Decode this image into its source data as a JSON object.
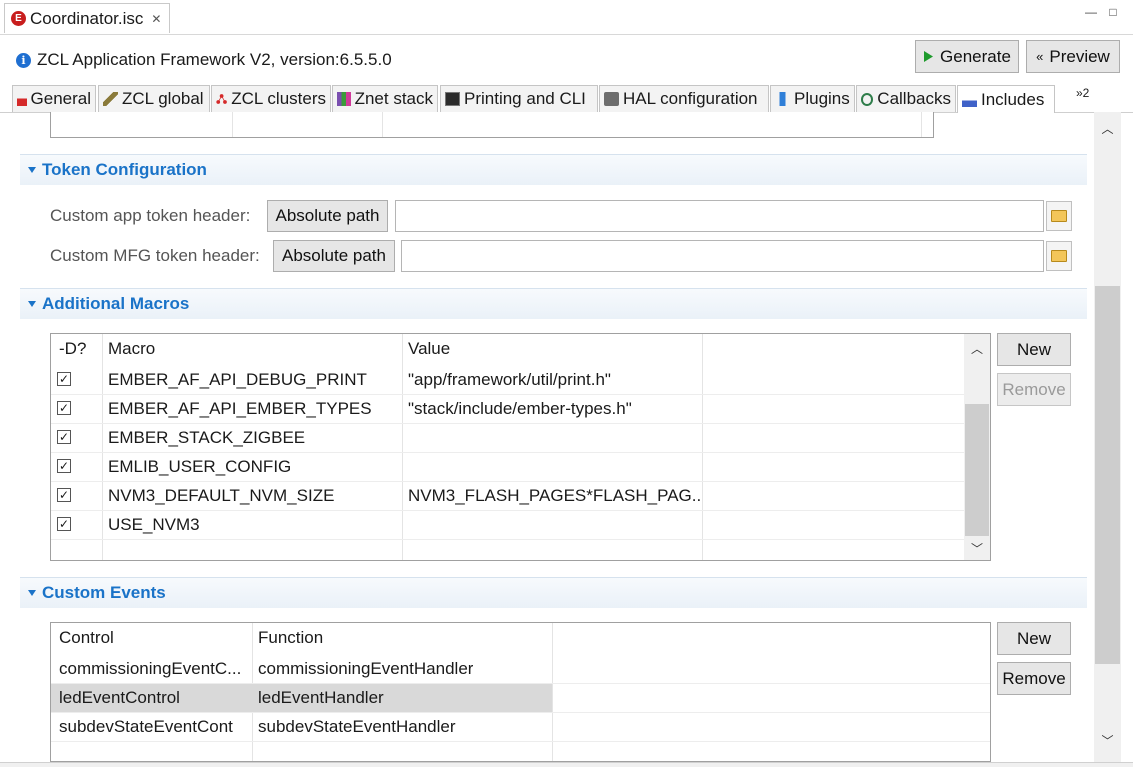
{
  "editor": {
    "tab_title": "Coordinator.isc",
    "close": "✕",
    "minimize": "—",
    "maximize": "□"
  },
  "header": {
    "title": "ZCL Application Framework V2, version:6.5.5.0",
    "generate_label": "Generate",
    "preview_label": "Preview"
  },
  "tabs": [
    {
      "label": "General",
      "icon": "general-icon"
    },
    {
      "label": "ZCL global",
      "icon": "wrench-icon"
    },
    {
      "label": "ZCL clusters",
      "icon": "clusters-icon"
    },
    {
      "label": "Znet stack",
      "icon": "stack-icon"
    },
    {
      "label": "Printing and CLI",
      "icon": "terminal-icon"
    },
    {
      "label": "HAL configuration",
      "icon": "chip-icon"
    },
    {
      "label": "Plugins",
      "icon": "plugin-icon"
    },
    {
      "label": "Callbacks",
      "icon": "callbacks-icon"
    },
    {
      "label": "Includes",
      "icon": "includes-icon"
    }
  ],
  "tabs_overflow": "»2",
  "token": {
    "title": "Token Configuration",
    "app_label": "Custom app token header:",
    "mfg_label": "Custom MFG token header:",
    "path_button": "Absolute path",
    "app_value": "",
    "mfg_value": ""
  },
  "macros": {
    "title": "Additional Macros",
    "headers": [
      "-D?",
      "Macro",
      "Value"
    ],
    "rows": [
      {
        "checked": "✓",
        "macro": "EMBER_AF_API_DEBUG_PRINT",
        "value": "\"app/framework/util/print.h\""
      },
      {
        "checked": "✓",
        "macro": "EMBER_AF_API_EMBER_TYPES",
        "value": "\"stack/include/ember-types.h\""
      },
      {
        "checked": "✓",
        "macro": "EMBER_STACK_ZIGBEE",
        "value": ""
      },
      {
        "checked": "✓",
        "macro": "EMLIB_USER_CONFIG",
        "value": ""
      },
      {
        "checked": "✓",
        "macro": "NVM3_DEFAULT_NVM_SIZE",
        "value": "NVM3_FLASH_PAGES*FLASH_PAG..."
      },
      {
        "checked": "✓",
        "macro": "USE_NVM3",
        "value": ""
      }
    ],
    "new_label": "New",
    "remove_label": "Remove"
  },
  "events": {
    "title": "Custom Events",
    "headers": [
      "Control",
      "Function"
    ],
    "rows": [
      {
        "control": "commissioningEventC...",
        "function": "commissioningEventHandler"
      },
      {
        "control": "ledEventControl",
        "function": "ledEventHandler"
      },
      {
        "control": "subdevStateEventCont",
        "function": "subdevStateEventHandler"
      }
    ],
    "new_label": "New",
    "remove_label": "Remove"
  },
  "colors": {
    "section_title": "#1a73c8",
    "selected_row": "#d9d9d9",
    "error_icon": "#c81e1e"
  }
}
